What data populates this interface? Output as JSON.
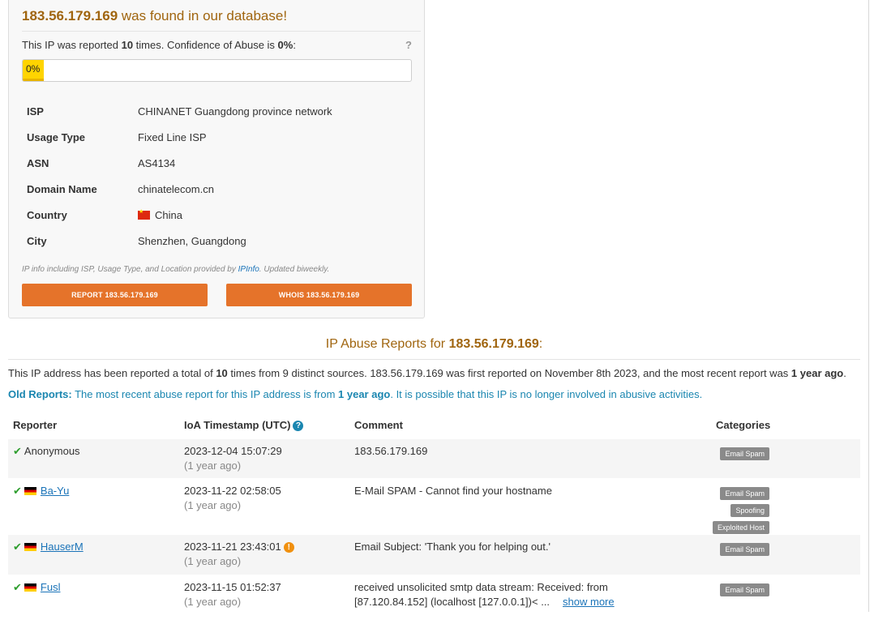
{
  "card": {
    "ip": "183.56.179.169",
    "found_suffix": " was found in our database!",
    "conf_prefix": "This IP was reported ",
    "report_count": "10",
    "conf_middle": " times. Confidence of Abuse is ",
    "confidence": "0%",
    "conf_suffix": ":",
    "confidence_fraction": 0,
    "help": "?",
    "bar_label": "0%",
    "info": [
      {
        "key": "ISP",
        "value": "CHINANET Guangdong province network"
      },
      {
        "key": "Usage Type",
        "value": "Fixed Line ISP"
      },
      {
        "key": "ASN",
        "value": "AS4134"
      },
      {
        "key": "Domain Name",
        "value": "chinatelecom.cn"
      },
      {
        "key": "Country",
        "value": "China",
        "flag": "cn-flag"
      },
      {
        "key": "City",
        "value": "Shenzhen, Guangdong"
      }
    ],
    "note_prefix": "IP info including ISP, Usage Type, and Location provided by ",
    "note_link": "IPInfo",
    "note_suffix": ". Updated biweekly.",
    "report_button": "REPORT 183.56.179.169",
    "whois_button": "WHOIS 183.56.179.169"
  },
  "reports": {
    "title_prefix": "IP Abuse Reports for ",
    "ip": "183.56.179.169",
    "title_suffix": ":",
    "summary": {
      "p1": "This IP address has been reported a total of ",
      "count": "10",
      "p2": " times from 9 distinct sources. 183.56.179.169 was first reported on November 8th 2023, and the most recent report was ",
      "recent": "1 year ago",
      "p3": "."
    },
    "old": {
      "label": "Old Reports:",
      "p1": " The most recent abuse report for this IP address is from ",
      "recent": "1 year ago",
      "p2": ". It is possible that this IP is no longer involved in abusive activities."
    },
    "columns": {
      "reporter": "Reporter",
      "timestamp": "IoA Timestamp (UTC)",
      "comment": "Comment",
      "categories": "Categories"
    },
    "rows": [
      {
        "reporter": "Anonymous",
        "flag": "",
        "timestamp": "2023-12-04 15:07:29",
        "ago": "(1 year ago)",
        "comment": "183.56.179.169",
        "comment2": "",
        "more": "",
        "warning": false,
        "categories": [
          "Email Spam"
        ]
      },
      {
        "reporter": "Ba-Yu",
        "flag": "de",
        "timestamp": "2023-11-22 02:58:05",
        "ago": "(1 year ago)",
        "comment": "E-Mail SPAM - Cannot find your hostname",
        "comment2": "",
        "more": "",
        "warning": false,
        "categories": [
          "Email Spam",
          "Spoofing",
          "Exploited Host"
        ]
      },
      {
        "reporter": "HauserM",
        "flag": "de",
        "timestamp": "2023-11-21 23:43:01",
        "ago": "(1 year ago)",
        "comment": "Email Subject: 'Thank you for helping out.'",
        "comment2": "",
        "more": "",
        "warning": true,
        "categories": [
          "Email Spam"
        ]
      },
      {
        "reporter": "Fusl",
        "flag": "de",
        "timestamp": "2023-11-15 01:52:37",
        "ago": "(1 year ago)",
        "comment": "received unsolicited smtp data stream: Received: from",
        "comment2": "[87.120.84.152] (localhost [127.0.0.1])< ...",
        "more": "show more",
        "warning": false,
        "categories": [
          "Email Spam"
        ]
      }
    ]
  }
}
